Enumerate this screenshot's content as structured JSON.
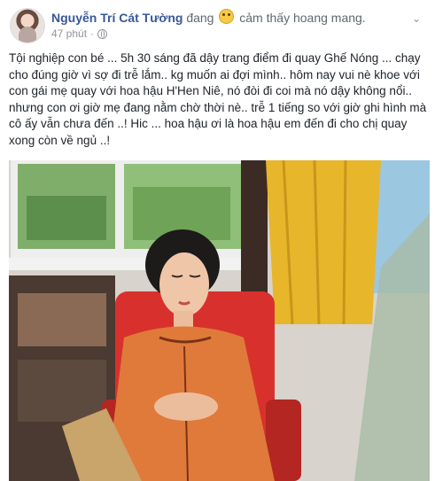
{
  "post": {
    "author": "Nguyễn Trí Cát Tường",
    "feeling_prefix": "đang",
    "feeling_icon": "confounded-face-icon",
    "feeling_text": "cảm thấy hoang mang.",
    "time": "47 phút",
    "separator": "·",
    "privacy_icon": "globe-icon",
    "text": "Tội nghiệp con bé ... 5h 30 sáng đã dậy trang điểm đi quay Ghế Nóng ... chạy cho đúng giờ vì sợ đi trễ lắm.. kg muốn ai đợi mình.. hôm nay vui nè khoe với con gái mẹ quay với hoa hậu H'Hen Niê, nó đòi đi coi mà nó dậy không nổi.. nhưng con ơi giờ mẹ đang nằm chờ thời nè.. trễ 1 tiếng so với giờ ghi hình mà cô ấy vẫn chưa đến ..! Hic ... hoa hậu ơi là hoa hậu em đến đi cho chị quay xong còn về ngủ ..!"
  },
  "colors": {
    "link": "#365899",
    "meta": "#90949c",
    "dress": "#e07a3a",
    "chair": "#d8312d",
    "curtain": "#e8b62a"
  }
}
